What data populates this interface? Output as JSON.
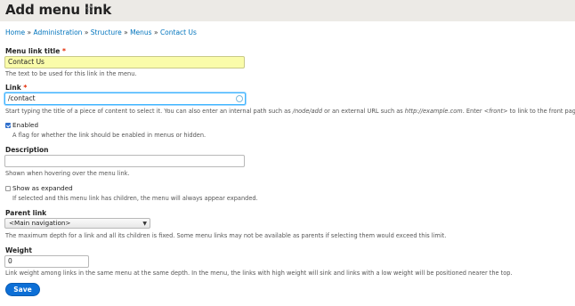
{
  "header": {
    "title": "Add menu link",
    "star_icon": "star-icon"
  },
  "breadcrumb": [
    "Home",
    "Administration",
    "Structure",
    "Menus",
    "Contact Us"
  ],
  "breadcrumb_separator": "»",
  "form": {
    "menu_link_title": {
      "label": "Menu link title",
      "required_marker": "*",
      "value": "Contact Us",
      "description": "The text to be used for this link in the menu."
    },
    "link": {
      "label": "Link",
      "required_marker": "*",
      "value": "/contact",
      "description_prefix": "Start typing the title of a piece of content to select it. You can also enter an internal path such as ",
      "description_path": "/node/add",
      "description_mid": " or an external URL such as ",
      "description_url": "http://example.com",
      "description_mid2": ". Enter ",
      "description_front": "<front>",
      "description_suffix": " to link to the front page."
    },
    "enabled": {
      "label": "Enabled",
      "checked": true,
      "description": "A flag for whether the link should be enabled in menus or hidden."
    },
    "description_field": {
      "label": "Description",
      "value": "",
      "description": "Shown when hovering over the menu link."
    },
    "show_as_expanded": {
      "label": "Show as expanded",
      "checked": false,
      "description": "If selected and this menu link has children, the menu will always appear expanded."
    },
    "parent_link": {
      "label": "Parent link",
      "selected": "<Main navigation>",
      "description": "The maximum depth for a link and all its children is fixed. Some menu links may not be available as parents if selecting them would exceed this limit."
    },
    "weight": {
      "label": "Weight",
      "value": "0",
      "description": "Link weight among links in the same menu at the same depth. In the menu, the links with high weight will sink and links with a low weight will be positioned nearer the top."
    },
    "save_label": "Save"
  },
  "colors": {
    "link": "#0074bd",
    "required": "#e32700",
    "save_button": "#0d6fd6",
    "highlight_field": "#fafcaa"
  }
}
